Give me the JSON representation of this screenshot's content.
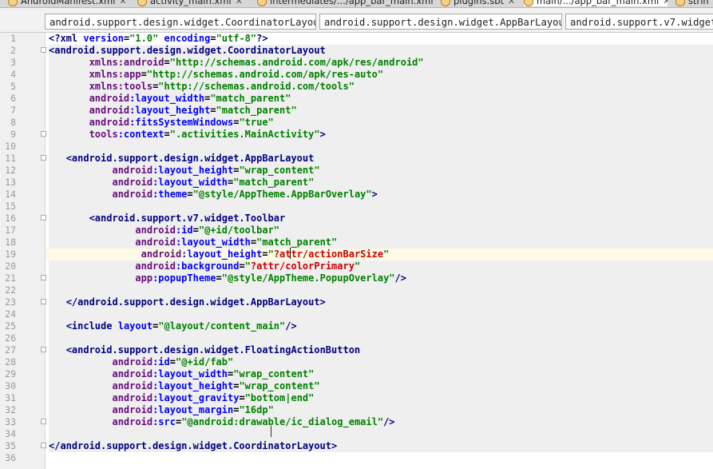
{
  "file_tabs": [
    {
      "label": "AndroidManifest.xml",
      "active": false
    },
    {
      "label": "activity_main.xml",
      "active": false
    },
    {
      "label": "intermediates/.../app_bar_main.xml",
      "active": false
    },
    {
      "label": "plugins.sbt",
      "active": false
    },
    {
      "label": "main/.../app_bar_main.xml",
      "active": true
    },
    {
      "label": "strin",
      "active": false
    }
  ],
  "breadcrumb": [
    "android.support.design.widget.CoordinatorLayout",
    "android.support.design.widget.AppBarLayout",
    "android.support.v7.widget."
  ],
  "line_numbers": [
    "1",
    "2",
    "3",
    "4",
    "5",
    "6",
    "7",
    "8",
    "9",
    "10",
    "11",
    "12",
    "13",
    "14",
    "15",
    "16",
    "17",
    "18",
    "19",
    "20",
    "21",
    "22",
    "23",
    "24",
    "25",
    "26",
    "27",
    "28",
    "29",
    "30",
    "31",
    "32",
    "33",
    "34",
    "35",
    "36"
  ],
  "code": {
    "l1": {
      "a": "<?",
      "b": "xml ",
      "c": "version",
      "d": "=",
      "e": "\"1.0\"",
      "f": " encoding",
      "g": "=",
      "h": "\"utf-8\"",
      "i": "?>"
    },
    "l2": "<android.support.design.widget.CoordinatorLayout",
    "l3": {
      "ns": "xmlns:android",
      "v": "\"http://schemas.android.com/apk/res/android\""
    },
    "l4": {
      "ns": "xmlns:app",
      "v": "\"http://schemas.android.com/apk/res-auto\""
    },
    "l5": {
      "ns": "xmlns:tools",
      "v": "\"http://schemas.android.com/tools\""
    },
    "l6": {
      "ns": "android",
      "a": ":layout_width",
      "v": "\"match_parent\""
    },
    "l7": {
      "ns": "android",
      "a": ":layout_height",
      "v": "\"match_parent\""
    },
    "l8": {
      "ns": "android",
      "a": ":fitsSystemWindows",
      "v": "\"true\""
    },
    "l9": {
      "ns": "tools",
      "a": ":context",
      "v": "\".activities.MainActivity\"",
      "end": ">"
    },
    "l11": "<android.support.design.widget.AppBarLayout",
    "l12": {
      "ns": "android",
      "a": ":layout_height",
      "v": "\"wrap_content\""
    },
    "l13": {
      "ns": "android",
      "a": ":layout_width",
      "v": "\"match_parent\""
    },
    "l14": {
      "ns": "android",
      "a": ":theme",
      "v": "\"@style/AppTheme.AppBarOverlay\"",
      "end": ">"
    },
    "l16": "<android.support.v7.widget.Toolbar",
    "l17": {
      "ns": "android",
      "a": ":id",
      "v": "\"@+id/toolbar\""
    },
    "l18": {
      "ns": "android",
      "a": ":layout_width",
      "v": "\"match_parent\""
    },
    "l19": {
      "ns": "android",
      "a": ":layout_height",
      "q": "\"",
      "r": "?attr/actionBarSize",
      "q2": "\""
    },
    "l20": {
      "ns": "android",
      "a": ":background",
      "q": "\"",
      "r": "?attr/colorPrimary",
      "q2": "\""
    },
    "l21": {
      "ns": "app",
      "a": ":popupTheme",
      "v": "\"@style/AppTheme.PopupOverlay\"",
      "end": "/>"
    },
    "l23": "</android.support.design.widget.AppBarLayout>",
    "l25": {
      "tag": "<include ",
      "a": "layout",
      "v": "\"@layout/content_main\"",
      "end": "/>"
    },
    "l27": "<android.support.design.widget.FloatingActionButton",
    "l28": {
      "ns": "android",
      "a": ":id",
      "v": "\"@+id/fab\""
    },
    "l29": {
      "ns": "android",
      "a": ":layout_width",
      "v": "\"wrap_content\""
    },
    "l30": {
      "ns": "android",
      "a": ":layout_height",
      "v": "\"wrap_content\""
    },
    "l31": {
      "ns": "android",
      "a": ":layout_gravity",
      "v": "\"bottom|end\""
    },
    "l32": {
      "ns": "android",
      "a": ":layout_margin",
      "v": "\"16dp\""
    },
    "l33": {
      "ns": "android",
      "a": ":src",
      "v": "\"@android:drawable/ic_dialog_email\"",
      "end": "/>"
    },
    "l35": "</android.support.design.widget.CoordinatorLayout>"
  },
  "colors": {
    "tag": "#000080",
    "namespace": "#660e7a",
    "attribute": "#0000ff",
    "value": "#008000",
    "reference": "#cc0000",
    "current_line": "#fdfbe6",
    "highlight": "#efefef"
  },
  "icons": {
    "tab_icon": "xml-file-icon",
    "close": "close-icon",
    "gutter_marker": "lightbulb-icon"
  }
}
